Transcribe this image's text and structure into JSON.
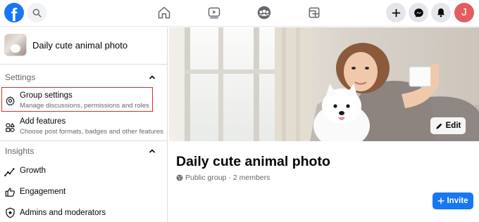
{
  "topbar": {
    "logo_letter": "f",
    "account_initial": "J",
    "icons": [
      "facebook-logo",
      "search-icon",
      "home-icon",
      "watch-icon",
      "groups-icon",
      "gaming-icon",
      "plus-icon",
      "messenger-icon",
      "notifications-icon",
      "account-avatar"
    ]
  },
  "sidebar": {
    "group_name": "Daily cute animal photo",
    "settings_section": "Settings",
    "insights_section": "Insights",
    "items": [
      {
        "title": "Group settings",
        "subtitle": "Manage discussions, permissions and roles",
        "icon": "gear-icon"
      },
      {
        "title": "Add features",
        "subtitle": "Choose post formats, badges and other features",
        "icon": "shapes-icon"
      },
      {
        "title": "Growth",
        "icon": "growth-chart-icon"
      },
      {
        "title": "Engagement",
        "icon": "thumbs-up-icon"
      },
      {
        "title": "Admins and moderators",
        "icon": "shield-icon"
      }
    ]
  },
  "main": {
    "edit_label": "Edit",
    "title": "Daily cute animal photo",
    "privacy": "Public group",
    "separator": "·",
    "members": "2 members",
    "invite_label": "Invite"
  },
  "colors": {
    "brand": "#1877f2",
    "highlight": "#d93025",
    "avatar": "#e35e62"
  }
}
